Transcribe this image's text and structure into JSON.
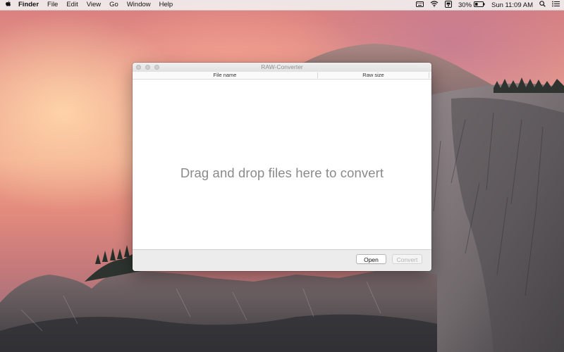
{
  "menubar": {
    "app_name": "Finder",
    "items": [
      "File",
      "Edit",
      "View",
      "Go",
      "Window",
      "Help"
    ],
    "battery_percent": "30%",
    "clock": "Sun 11:09 AM"
  },
  "window": {
    "title": "RAW-Converter",
    "columns": [
      "File name",
      "Raw size"
    ],
    "drop_message": "Drag and drop files here to convert",
    "buttons": {
      "open": "Open",
      "convert": "Convert"
    }
  },
  "colors": {
    "window_bg": "#ffffff",
    "footer_bg": "#ececec",
    "drop_text": "#8a8a8a",
    "disabled_text": "#b4b4b4"
  }
}
